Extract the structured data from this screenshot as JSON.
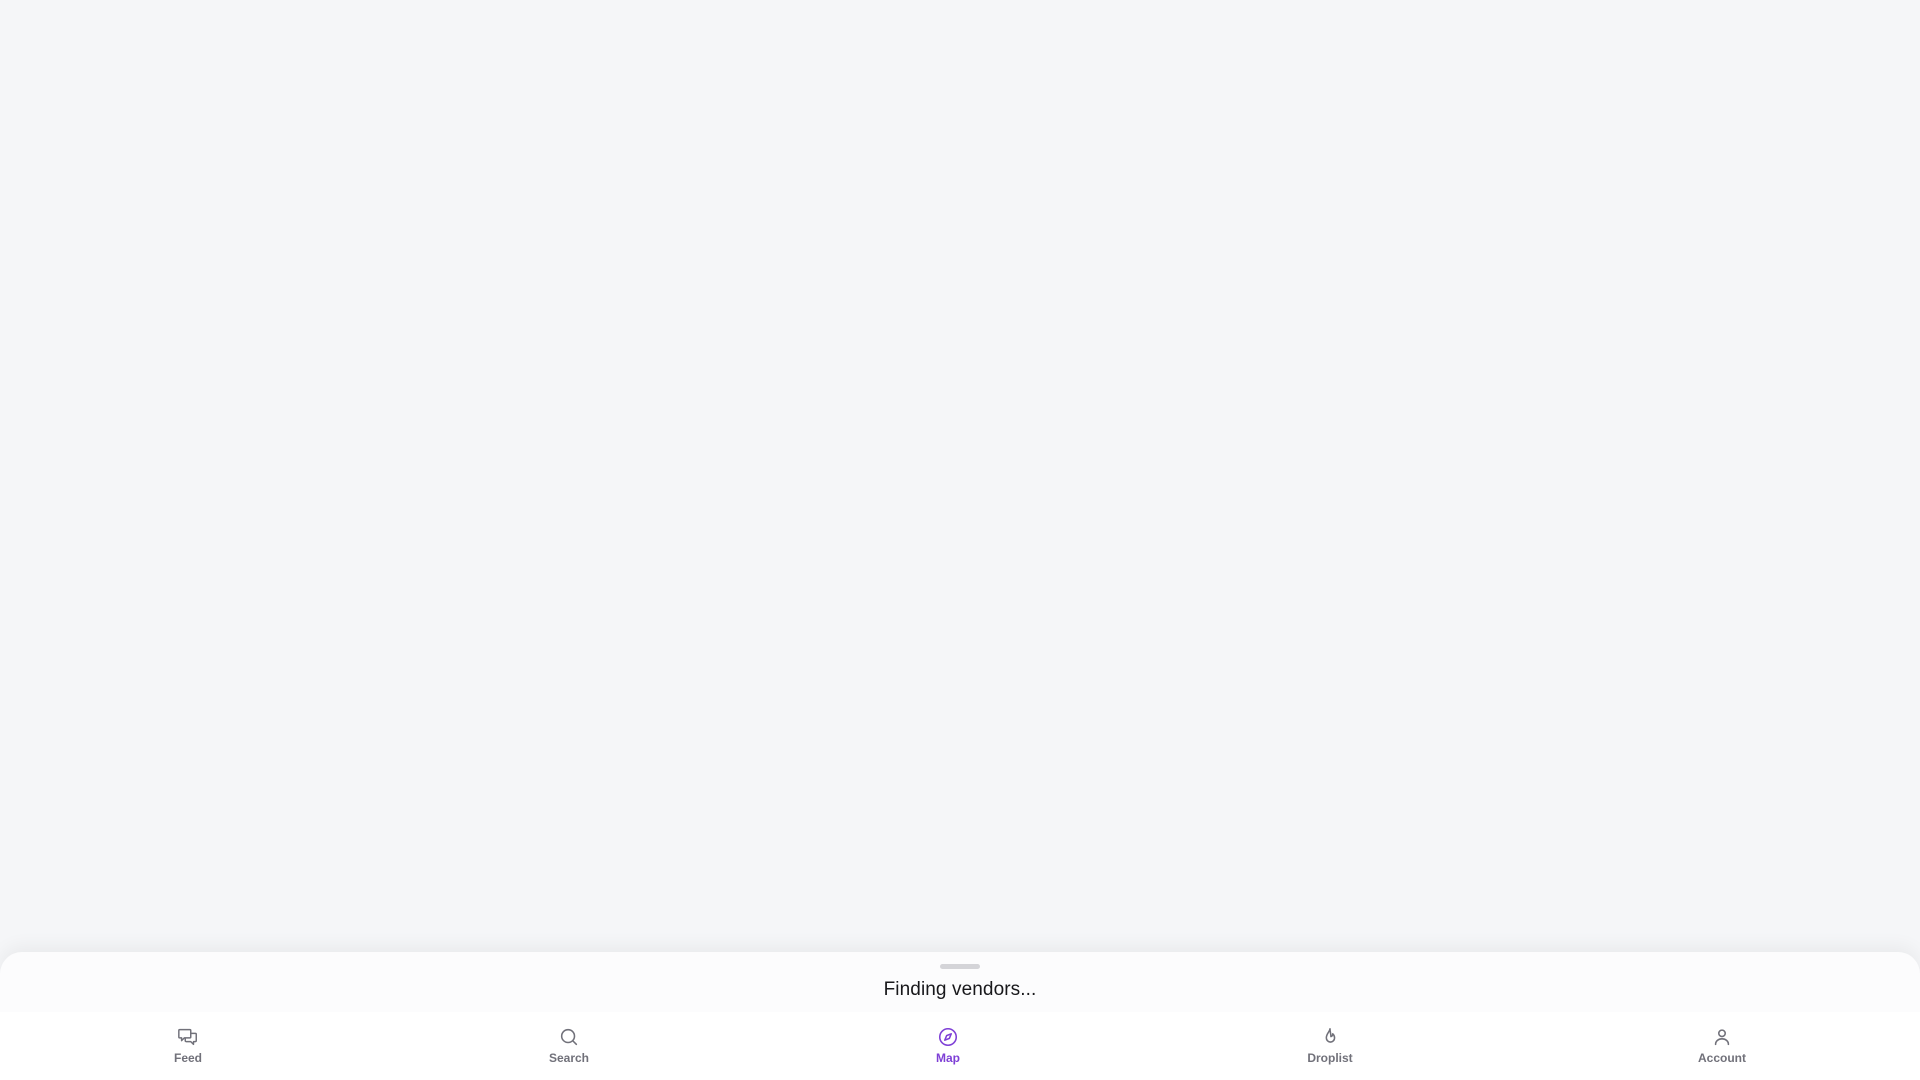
{
  "sheet": {
    "status_text": "Finding vendors..."
  },
  "tabbar": {
    "active": "map",
    "active_color": "#7e3fd6",
    "inactive_color": "#71717a",
    "items": [
      {
        "id": "feed",
        "label": "Feed",
        "icon": "chat-bubbles-icon"
      },
      {
        "id": "search",
        "label": "Search",
        "icon": "search-icon"
      },
      {
        "id": "map",
        "label": "Map",
        "icon": "compass-icon"
      },
      {
        "id": "droplist",
        "label": "Droplist",
        "icon": "flame-icon"
      },
      {
        "id": "account",
        "label": "Account",
        "icon": "user-icon"
      }
    ]
  }
}
